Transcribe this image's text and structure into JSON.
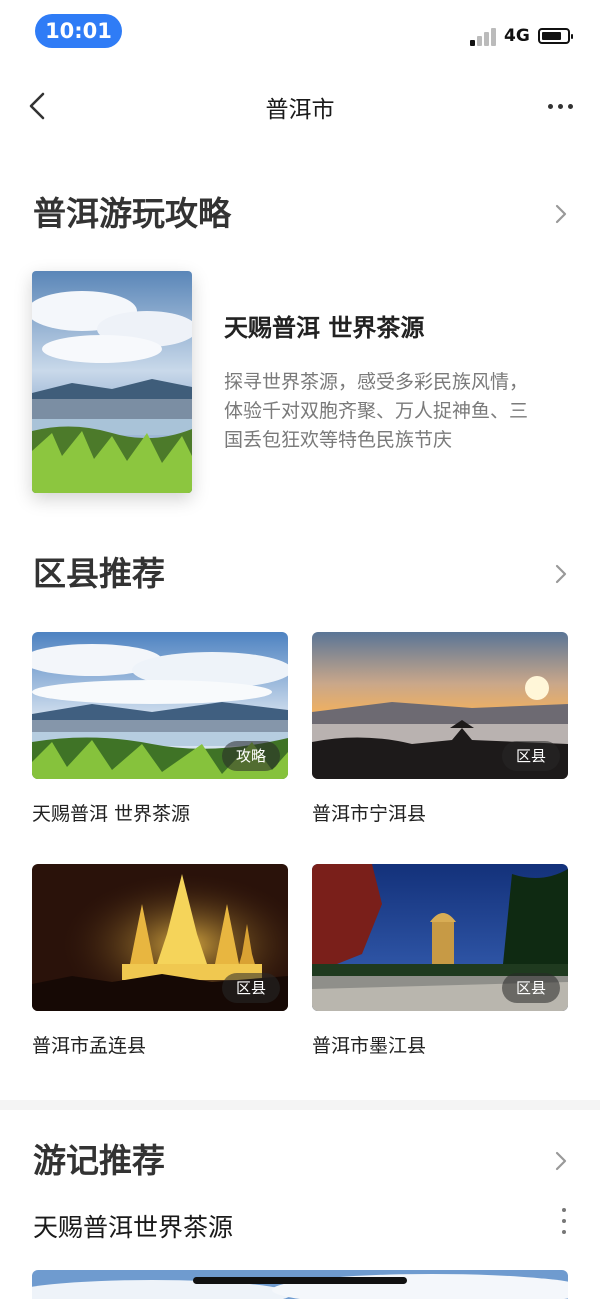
{
  "status": {
    "time": "10:01",
    "network": "4G",
    "battery_level": 0.8
  },
  "nav": {
    "title": "普洱市"
  },
  "guide_section": {
    "title": "普洱游玩攻略",
    "card": {
      "title": "天赐普洱 世界茶源",
      "desc_lines": [
        "探寻世界茶源，感受多彩民族风情，",
        "体验千对双胞齐聚、万人捉神鱼、三",
        "国丢包狂欢等特色民族节庆"
      ]
    }
  },
  "county_section": {
    "title": "区县推荐",
    "cards": [
      {
        "label": "天赐普洱 世界茶源",
        "tag": "攻略"
      },
      {
        "label": "普洱市宁洱县",
        "tag": "区县"
      },
      {
        "label": "普洱市孟连县",
        "tag": "区县"
      },
      {
        "label": "普洱市墨江县",
        "tag": "区县"
      }
    ]
  },
  "notes_section": {
    "title": "游记推荐",
    "first_note_title": "天赐普洱世界茶源"
  },
  "colors": {
    "accent": "#2f7cf6",
    "title": "#333333",
    "desc": "#7a7a7a"
  },
  "icons": {
    "back": "chevron-left-icon",
    "more": "more-horizontal-icon",
    "section_more": "chevron-right-icon"
  }
}
